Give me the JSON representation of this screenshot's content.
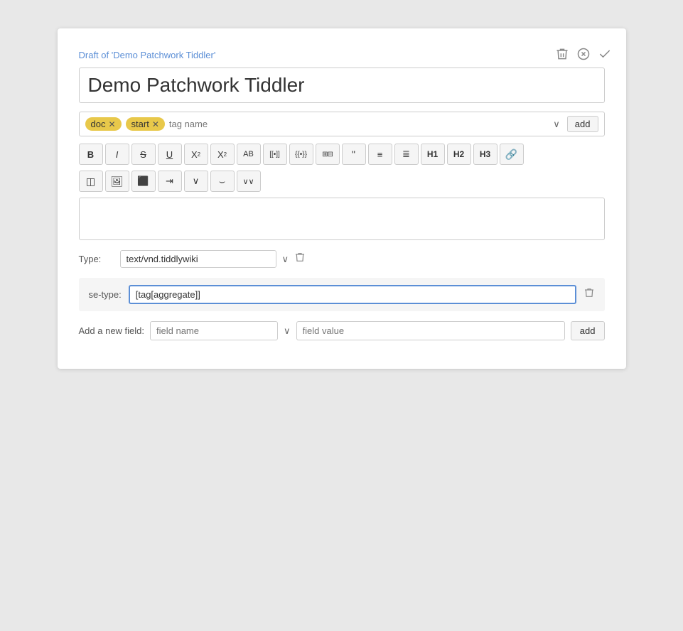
{
  "draft_label": "Draft of 'Demo Patchwork Tiddler'",
  "title": "Demo Patchwork Tiddler",
  "tags": [
    {
      "label": "doc",
      "id": "tag-doc"
    },
    {
      "label": "start",
      "id": "tag-start"
    }
  ],
  "tag_input_placeholder": "tag name",
  "add_tag_label": "add",
  "toolbar": {
    "buttons": [
      {
        "id": "bold",
        "label": "B",
        "style": "bold"
      },
      {
        "id": "italic",
        "label": "I",
        "style": "italic"
      },
      {
        "id": "strikethrough",
        "label": "S",
        "style": "strike"
      },
      {
        "id": "underline",
        "label": "U",
        "style": "underline"
      },
      {
        "id": "superscript",
        "label": "X²",
        "style": "normal"
      },
      {
        "id": "subscript",
        "label": "X₂",
        "style": "normal"
      },
      {
        "id": "uppercase",
        "label": "AB",
        "style": "normal"
      },
      {
        "id": "ext-link",
        "label": "[[•]]",
        "style": "normal"
      },
      {
        "id": "macro",
        "label": "{{•}}",
        "style": "normal"
      },
      {
        "id": "table",
        "label": "⊞",
        "style": "normal"
      },
      {
        "id": "blockquote",
        "label": "❝",
        "style": "normal"
      },
      {
        "id": "bullet-list",
        "label": "≡•",
        "style": "normal"
      },
      {
        "id": "num-list",
        "label": "≡1",
        "style": "normal"
      },
      {
        "id": "h1",
        "label": "H1",
        "style": "normal"
      },
      {
        "id": "h2",
        "label": "H2",
        "style": "normal"
      },
      {
        "id": "h3",
        "label": "H3",
        "style": "normal"
      },
      {
        "id": "link",
        "label": "🔗",
        "style": "normal"
      }
    ],
    "row2": [
      {
        "id": "widget",
        "label": "◫",
        "style": "normal"
      },
      {
        "id": "image",
        "label": "🖼",
        "style": "normal"
      },
      {
        "id": "stamp",
        "label": "⬛",
        "style": "normal"
      },
      {
        "id": "indent",
        "label": "⇥",
        "style": "normal"
      },
      {
        "id": "dropdown2",
        "label": "∨",
        "style": "normal"
      },
      {
        "id": "tilde",
        "label": "⌣",
        "style": "normal"
      },
      {
        "id": "more",
        "label": "∨∨",
        "style": "normal"
      }
    ]
  },
  "type": {
    "label": "Type:",
    "value": "text/vnd.tiddlywiki",
    "placeholder": "text/vnd.tiddlywiki"
  },
  "se_field": {
    "label": "se-type:",
    "value": "[tag[aggregate]]"
  },
  "add_field": {
    "label": "Add a new field:",
    "name_placeholder": "field name",
    "value_placeholder": "field value",
    "add_label": "add"
  },
  "icons": {
    "trash": "🗑",
    "cancel": "⊗",
    "confirm": "✓",
    "chevron_down": "∨",
    "delete": "🗑"
  }
}
